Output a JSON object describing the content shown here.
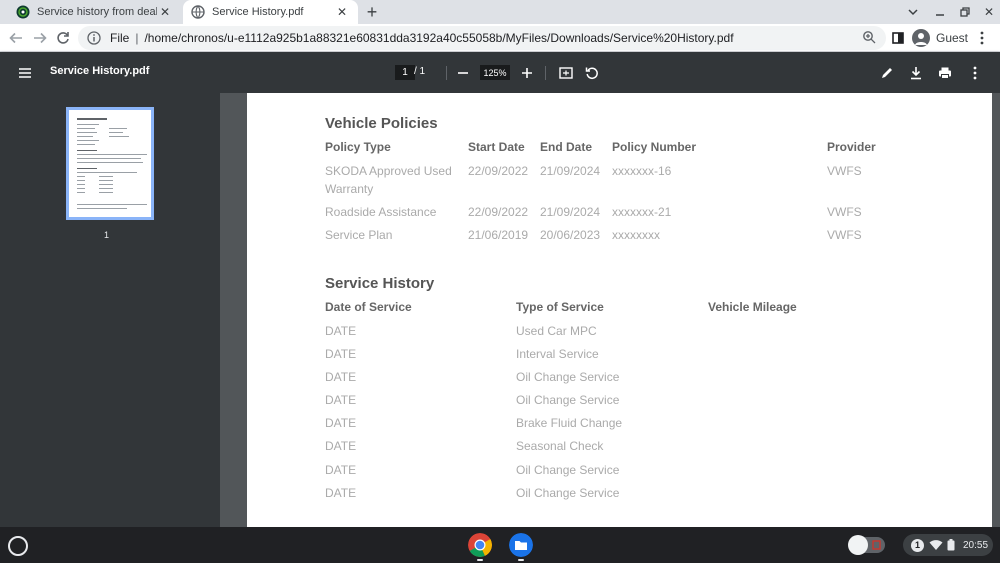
{
  "tabs": [
    {
      "title": "Service history from dealer - Skoda",
      "active": false
    },
    {
      "title": "Service History.pdf",
      "active": true
    }
  ],
  "toolbar": {
    "scheme": "File",
    "url": "/home/chronos/u-e1112a925b1a88321e60831dda3192a40c55058b/MyFiles/Downloads/Service%20History.pdf",
    "profile_label": "Guest"
  },
  "pdf_header": {
    "title": "Service History.pdf",
    "current_page": "1",
    "total_pages": "/ 1",
    "zoom": "125%"
  },
  "sidebar": {
    "thumbnail_page_number": "1"
  },
  "document": {
    "policies": {
      "heading": "Vehicle Policies",
      "columns": [
        "Policy Type",
        "Start Date",
        "End Date",
        "Policy Number",
        "Provider"
      ],
      "rows": [
        {
          "type_line1": "SKODA Approved Used",
          "type_line2": "Warranty",
          "start": "22/09/2022",
          "end": "21/09/2024",
          "number": "xxxxxxx-16",
          "provider": "VWFS"
        },
        {
          "type_line1": "Roadside Assistance",
          "type_line2": "",
          "start": "22/09/2022",
          "end": "21/09/2024",
          "number": "xxxxxxx-21",
          "provider": "VWFS"
        },
        {
          "type_line1": "Service Plan",
          "type_line2": "",
          "start": "21/06/2019",
          "end": "20/06/2023",
          "number": "xxxxxxxx",
          "provider": "VWFS"
        }
      ]
    },
    "service_history": {
      "heading": "Service History",
      "columns": [
        "Date of Service",
        "Type of Service",
        "Vehicle Mileage"
      ],
      "rows": [
        {
          "date": "DATE",
          "type": "Used Car MPC"
        },
        {
          "date": "DATE",
          "type": "Interval Service"
        },
        {
          "date": "DATE",
          "type": "Oil Change Service"
        },
        {
          "date": "DATE",
          "type": "Oil Change Service"
        },
        {
          "date": "DATE",
          "type": "Brake Fluid Change"
        },
        {
          "date": "DATE",
          "type": "Seasonal Check"
        },
        {
          "date": "DATE",
          "type": "Oil Change Service"
        },
        {
          "date": "DATE",
          "type": "Oil Change Service"
        }
      ]
    }
  },
  "shelf": {
    "notification_count": "1",
    "clock": "20:55"
  },
  "colors": {
    "accent": "#8ab4f8",
    "pdf_toolbar": "#323639",
    "doc_background": "#525659"
  }
}
